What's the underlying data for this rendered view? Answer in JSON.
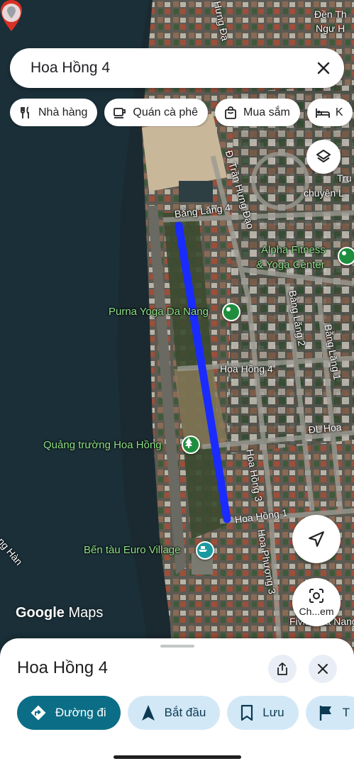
{
  "search": {
    "query": "Hoa Hồng 4"
  },
  "chips": [
    {
      "label": "Nhà hàng",
      "icon": "restaurant-icon"
    },
    {
      "label": "Quán cà phê",
      "icon": "cafe-icon"
    },
    {
      "label": "Mua sắm",
      "icon": "shopping-bag-icon"
    },
    {
      "label": "K",
      "icon": "hotel-icon"
    }
  ],
  "map": {
    "streets": {
      "bang_lang_4": "Bằng Lăng 4",
      "tran_hung_dao": "Đ. Trần Hưng Đạo",
      "hung_dao_top": "Hưng Đạ",
      "bang_lang_2": "Bằng Lăng 2",
      "bang_lang_1": "Bằng Lăng 1",
      "hoa_hong_4": "Hoa Hồng 4",
      "dl_hoa": "ĐL Hoa",
      "hoa_hong_3": "Hoa Hồng 3",
      "hoa_hong_1": "Hoa Hồng 1",
      "hoa_phuong_3": "Hoa Phượng 3",
      "song_han": "ng Hàn",
      "truong_partial": "Tru",
      "chuyen_partial": "chuyên L",
      "den_partial": "Đền Th",
      "nguyen_partial": "Ngư H",
      "fivitel": "Fivitel Da Nang H"
    },
    "pois": {
      "alpha_fitness_line1": "Alpha Fitness",
      "alpha_fitness_line2": "& Yoga Center",
      "purna_yoga": "Purna Yoga Da Nang",
      "quang_truong": "Quảng trường Hoa Hồng",
      "ben_tau": "Bến tàu Euro Village"
    },
    "google_logo_bold": "Google",
    "google_logo_light": " Maps",
    "route_color": "#1a2bff"
  },
  "lens_button": {
    "label": "Ch...em"
  },
  "sheet": {
    "title": "Hoa Hồng 4",
    "actions": [
      {
        "label": "Đường đi",
        "icon": "directions-icon",
        "primary": true
      },
      {
        "label": "Bắt đầu",
        "icon": "navigation-arrow-icon",
        "primary": false
      },
      {
        "label": "Lưu",
        "icon": "bookmark-icon",
        "primary": false
      },
      {
        "label": "T",
        "icon": "flag-icon",
        "primary": false
      }
    ]
  }
}
